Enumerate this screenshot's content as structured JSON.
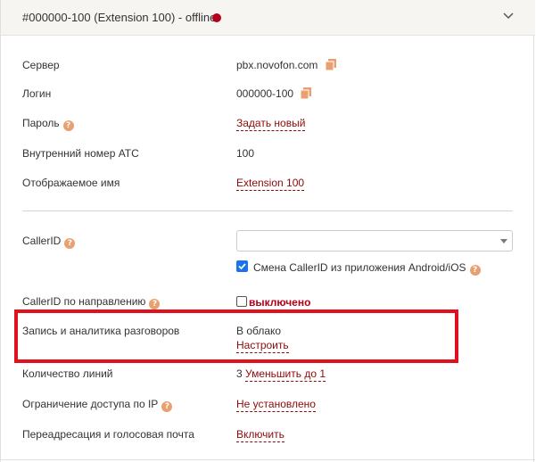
{
  "header": {
    "title": "#000000-100 (Extension 100) - offline",
    "status_color": "#b3001b"
  },
  "rows": {
    "server": {
      "label": "Сервер",
      "value": "pbx.novofon.com"
    },
    "login": {
      "label": "Логин",
      "value": "000000-100"
    },
    "password": {
      "label": "Пароль",
      "link": "Задать новый"
    },
    "internal_number": {
      "label": "Внутренний номер АТС",
      "value": "100"
    },
    "display_name": {
      "label": "Отображаемое имя",
      "link": "Extension 100"
    },
    "callerid": {
      "label": "CallerID",
      "select_value": "",
      "checkbox_label": "Смена CallerID из приложения Android/iOS",
      "checkbox_checked": true
    },
    "callerid_direction": {
      "label": "CallerID по направлению",
      "checkbox_checked": false,
      "status": "выключено"
    },
    "recording": {
      "label": "Запись и аналитика разговоров",
      "value": "В облако",
      "link": "Настроить"
    },
    "lines": {
      "label": "Количество линий",
      "value": "3",
      "link": "Уменьшить до 1"
    },
    "ip_restriction": {
      "label": "Ограничение доступа по IP",
      "link": "Не установлено"
    },
    "forwarding": {
      "label": "Переадресация и голосовая почта",
      "link": "Включить"
    }
  },
  "icons": {
    "copy": "copy-icon",
    "help": "help-icon",
    "chevron": "chevron-down-icon"
  },
  "colors": {
    "link": "#8b0a0a",
    "accent": "#e8a070",
    "highlight": "#e0101c",
    "checkbox": "#1a73e8"
  }
}
